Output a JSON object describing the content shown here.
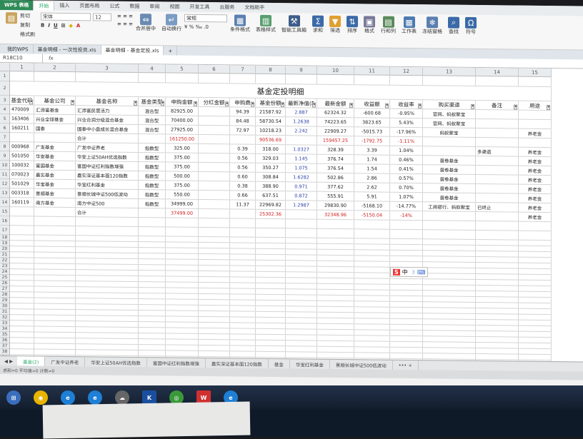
{
  "app": {
    "badge": "WPS 表格"
  },
  "menu": [
    "开始",
    "插入",
    "页面布局",
    "公式",
    "数据",
    "审阅",
    "视图",
    "开发工具",
    "云服务",
    "文档助手"
  ],
  "ribbon": {
    "cut": "剪切",
    "copy": "复制",
    "format_painter": "格式刷",
    "font": "宋体",
    "font_size": "12",
    "number_format": "常规",
    "merge_center": "合并居中",
    "wrap": "自动换行",
    "conditional_format": "条件格式",
    "table_style": "表格样式",
    "smart_toolbox": "智能工具箱",
    "sum": "求和",
    "filter": "筛选",
    "sort": "排序",
    "format": "格式",
    "row_col": "行和列",
    "worksheet": "工作表",
    "freeze": "冻结窗格",
    "find": "查找",
    "symbol": "符号"
  },
  "doc_tabs": [
    "我的WPS",
    "基金明细 - 一次性投资.xls",
    "基金明细 - 基金定投.xls"
  ],
  "namebox": "R18C10",
  "fx": "fx",
  "col_headers": [
    "1",
    "2",
    "3",
    "4",
    "5",
    "6",
    "7",
    "8",
    "9",
    "10",
    "11",
    "12",
    "13",
    "14",
    "15"
  ],
  "row_headers": [
    "1",
    "2",
    "3",
    "4",
    "5",
    "6",
    "7",
    "8",
    "9",
    "10",
    "11",
    "12",
    "13",
    "14",
    "15",
    "16",
    "17",
    "18",
    "19",
    "20",
    "21",
    "22",
    "23",
    "24",
    "25",
    "26",
    "27",
    "28",
    "29",
    "30",
    "31",
    "32",
    "33",
    "34",
    "35",
    "36",
    "37",
    "38",
    "39",
    "40",
    "41",
    "42",
    "43",
    "44",
    "45",
    "46",
    "47"
  ],
  "sheet": {
    "title": "基金定投明细",
    "headers": [
      "基金代码",
      "基金公司",
      "基金名称",
      "基金类型",
      "申购金额",
      "分红金额",
      "申购费",
      "基金份额",
      "最新净值(ξ",
      "最新金额",
      "收益额",
      "收益率",
      "购买渠道",
      "备注",
      "用途"
    ],
    "rows": [
      [
        "470009",
        "汇添富基金",
        "汇添富民营活力",
        "混合型",
        "82925.00",
        "",
        "94.39",
        "21587.92",
        "2.887",
        "62324.32",
        "-600.68",
        "-0.95%",
        "官网、蚂蚁聚宝",
        "",
        ""
      ],
      [
        "163406",
        "兴业全球基金",
        "兴业合润分级混合基金",
        "混合型",
        "70400.00",
        "",
        "84.48",
        "58730.54",
        "1.2638",
        "74223.65",
        "3823.65",
        "5.43%",
        "官网、蚂蚁聚宝",
        "",
        ""
      ],
      [
        "160211",
        "国泰",
        "国泰中小盘成长混合基金",
        "混合型",
        "27925.00",
        "",
        "72.97",
        "10218.23",
        "2.242",
        "22909.27",
        "-5015.73",
        "-17.96%",
        "蚂蚁聚宝",
        "",
        "养老金"
      ],
      [
        "",
        "",
        "合计",
        "",
        "161250.00",
        "",
        "",
        "90536.69",
        "",
        "159457.25",
        "-1792.75",
        "-1.11%",
        "",
        "",
        ""
      ],
      [
        "000968",
        "广发基金",
        "广发中证养老",
        "指数型",
        "325.00",
        "",
        "0.39",
        "318.00",
        "1.0327",
        "328.39",
        "3.39",
        "1.04%",
        "",
        "多渠道",
        "养老金"
      ],
      [
        "501050",
        "华安基金",
        "华安上证50AH优选指数",
        "指数型",
        "375.00",
        "",
        "0.56",
        "329.03",
        "1.145",
        "376.74",
        "1.74",
        "0.46%",
        "蛋卷基金",
        "",
        "养老金"
      ],
      [
        "100032",
        "富国基金",
        "富国中证红利指数增强",
        "指数型",
        "375.00",
        "",
        "0.56",
        "350.27",
        "1.075",
        "376.54",
        "1.54",
        "0.41%",
        "蛋卷基金",
        "",
        "养老金"
      ],
      [
        "070023",
        "嘉实基金",
        "嘉实深证基本面120指数",
        "指数型",
        "500.00",
        "",
        "0.60",
        "308.84",
        "1.6282",
        "502.86",
        "2.86",
        "0.57%",
        "蛋卷基金",
        "",
        "养老金"
      ],
      [
        "501029",
        "华宝基金",
        "华宝红利基金",
        "指数型",
        "375.00",
        "",
        "0.38",
        "388.90",
        "0.971",
        "377.62",
        "2.62",
        "0.70%",
        "蛋卷基金",
        "",
        "养老金"
      ],
      [
        "003318",
        "景顺基金",
        "景顺长城中证500低波动",
        "指数型",
        "550.00",
        "",
        "0.66",
        "637.51",
        "0.872",
        "555.91",
        "5.91",
        "1.07%",
        "蛋卷基金",
        "",
        "养老金"
      ],
      [
        "160119",
        "南方基金",
        "南方中证500",
        "指数型",
        "34999.00",
        "",
        "11.37",
        "22969.82",
        "1.2987",
        "29830.90",
        "-5168.10",
        "-14.77%",
        "工商银行、蚂蚁聚宝",
        "已终止",
        "养老金"
      ],
      [
        "",
        "",
        "合计",
        "",
        "37499.00",
        "",
        "",
        "25302.36",
        "",
        "32348.96",
        "-5150.04",
        "-14%",
        "",
        "",
        "养老金"
      ]
    ]
  },
  "sheet_tabs": [
    "基金(2)",
    "广发中证养老",
    "华安上证50AH优选指数",
    "富国中证红利指数增强",
    "嘉实深证基本面120指数",
    "基金",
    "华宝红利基金",
    "景顺长城中证500低波动"
  ],
  "status_text": "求和=0  平均值=0  计数=0",
  "ime": "中"
}
